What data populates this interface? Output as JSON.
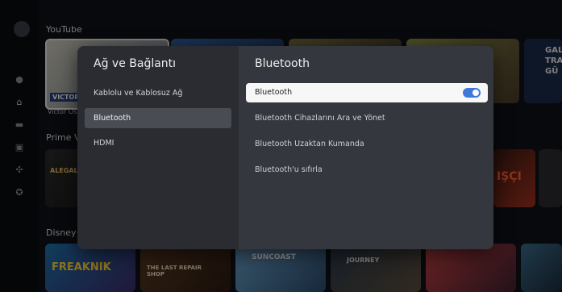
{
  "background": {
    "rows": [
      {
        "title": "YouTube"
      },
      {
        "title": "Prime Video"
      },
      {
        "title": "Disney+"
      }
    ],
    "tiles": {
      "victor_label": "VICTOR OS",
      "victor_caption": "Victor Os",
      "gala_label": "GALA TRA GÜ",
      "alegal_label": "ALEGAL ME",
      "isci_label": "IŞÇI",
      "freaknik_label": "FREAKNIK",
      "last_repair_label": "THE LAST REPAIR SHOP",
      "suncoast_label": "SUNCOAST",
      "journey_label": "JOURNEY"
    }
  },
  "dialog": {
    "left": {
      "title": "Ağ ve Bağlantı",
      "items": [
        {
          "label": "Kablolu ve Kablosuz Ağ"
        },
        {
          "label": "Bluetooth"
        },
        {
          "label": "HDMI"
        }
      ]
    },
    "right": {
      "title": "Bluetooth",
      "items": [
        {
          "label": "Bluetooth"
        },
        {
          "label": "Bluetooth Cihazlarını Ara ve Yönet"
        },
        {
          "label": "Bluetooth Uzaktan Kumanda"
        },
        {
          "label": "Bluetooth'u sıfırla"
        }
      ],
      "bluetooth_enabled": true
    }
  },
  "colors": {
    "toggle_on": "#3f78d8",
    "focused_bg": "#f7f7f8",
    "selected_bg": "#4a4c53"
  }
}
